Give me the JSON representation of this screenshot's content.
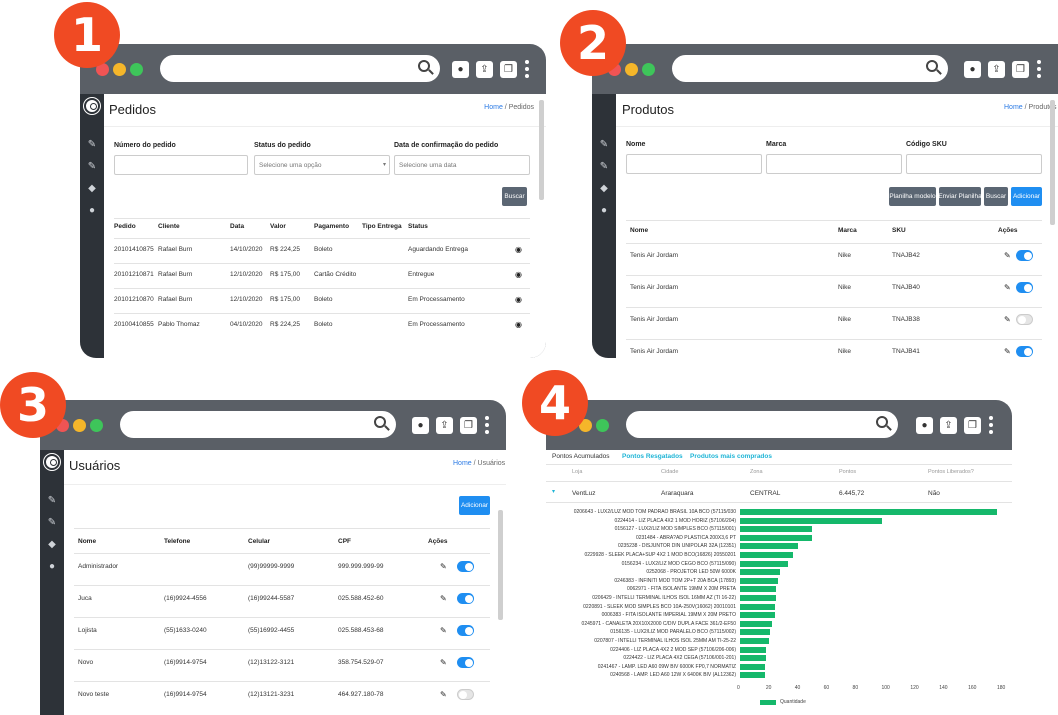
{
  "badges": [
    "1",
    "2",
    "3",
    "4"
  ],
  "colors": {
    "sidebar": "#2d3238",
    "accent": "#1f8ef1",
    "badge": "#f04a23",
    "bar": "#15b86b"
  },
  "p1": {
    "title": "Pedidos",
    "crumb_home": "Home",
    "crumb_sep": " / ",
    "crumb_current": "Pedidos",
    "filters": {
      "order_number_label": "Número do pedido",
      "status_label": "Status do pedido",
      "status_placeholder": "Selecione uma opção",
      "date_label": "Data de confirmação do pedido",
      "date_placeholder": "Selecione uma data"
    },
    "search_button": "Buscar",
    "columns": [
      "Pedido",
      "Cliente",
      "Data",
      "Valor",
      "Pagamento",
      "Tipo Entrega",
      "Status"
    ],
    "rows": [
      [
        "20101410875",
        "Rafael Burn",
        "14/10/2020",
        "R$ 224,25",
        "Boleto",
        "",
        "Aguardando Entrega"
      ],
      [
        "20101210871",
        "Rafael Burn",
        "12/10/2020",
        "R$ 175,00",
        "Cartão Crédito",
        "",
        "Entregue"
      ],
      [
        "20101210870",
        "Rafael Burn",
        "12/10/2020",
        "R$ 175,00",
        "Boleto",
        "",
        "Em Processamento"
      ],
      [
        "20100410855",
        "Pablo Thomaz",
        "04/10/2020",
        "R$ 224,25",
        "Boleto",
        "",
        "Em Processamento"
      ]
    ]
  },
  "p2": {
    "title": "Produtos",
    "crumb_home": "Home",
    "crumb_sep": " / ",
    "crumb_current": "Produtos",
    "filters": {
      "name_label": "Nome",
      "brand_label": "Marca",
      "sku_label": "Código SKU"
    },
    "buttons": {
      "template": "Planilha modelo",
      "upload": "Enviar Planilha",
      "search": "Buscar",
      "add": "Adicionar"
    },
    "columns": [
      "Nome",
      "Marca",
      "SKU",
      "Ações"
    ],
    "rows": [
      {
        "name": "Tenis Air Jordam",
        "brand": "Nike",
        "sku": "TNAJB42",
        "active": true
      },
      {
        "name": "Tenis Air Jordam",
        "brand": "Nike",
        "sku": "TNAJB40",
        "active": true
      },
      {
        "name": "Tenis Air Jordam",
        "brand": "Nike",
        "sku": "TNAJB38",
        "active": false
      },
      {
        "name": "Tenis Air Jordam",
        "brand": "Nike",
        "sku": "TNAJB41",
        "active": true
      }
    ]
  },
  "p3": {
    "title": "Usuários",
    "crumb_home": "Home",
    "crumb_sep": " / ",
    "crumb_current": "Usuários",
    "add_button": "Adicionar",
    "columns": [
      "Nome",
      "Telefone",
      "Celular",
      "CPF",
      "Ações"
    ],
    "rows": [
      {
        "name": "Administrador",
        "phone": "",
        "mobile": "(99)99999-9999",
        "cpf": "999.999.999-99",
        "active": true
      },
      {
        "name": "Juca",
        "phone": "(16)9924-4556",
        "mobile": "(16)99244-5587",
        "cpf": "025.588.452-60",
        "active": true
      },
      {
        "name": "Lojista",
        "phone": "(55)1633-0240",
        "mobile": "(55)16992-4455",
        "cpf": "025.588.453-68",
        "active": true
      },
      {
        "name": "Novo",
        "phone": "(16)9914-9754",
        "mobile": "(12)13122-3121",
        "cpf": "358.754.529-07",
        "active": true
      },
      {
        "name": "Novo teste",
        "phone": "(16)9914-9754",
        "mobile": "(12)13121-3231",
        "cpf": "464.927.180-78",
        "active": false
      }
    ]
  },
  "p4": {
    "tabs": [
      "Pontos Acumulados",
      "Pontos Resgatados",
      "Produtos mais comprados"
    ],
    "columns": [
      "Loja",
      "Cidade",
      "Zona",
      "Pontos",
      "Pontos Liberados?"
    ],
    "row": {
      "store": "VentLuz",
      "city": "Araraquara",
      "zone": "CENTRAL",
      "points": "6.445,72",
      "released": "Não"
    },
    "chart_data": {
      "type": "bar",
      "orientation": "horizontal",
      "categories": [
        "0206643 - LUX2/LUZ MOD TOM PADRAO BRASIL 10A BCO (57115/030",
        "0224414 - LIZ PLACA 4X2 1 MOD HORIZ (57106/204)",
        "0156127 - LUX2/LIZ MOD SIMPLES BCO (57115/001)",
        "0231484 - ABRA?AD PLASTICA 200X3,6 PT",
        "0235238 - DISJUNTOR DIN UNIPOLAR 32A (12351)",
        "0229928 - SLEEK PLACA+SUP 4X2 1 MOD BCO(16826) 20550201",
        "0156234 - LUX2/LIZ MOD CEGO BCO (57115/090)",
        "0252068 - PROJETOR LED 50W 6000K",
        "0246383 - INFINITI MOD TOM 2P+T 20A BCA (17893)",
        "0062971 - FITA ISOLANTE 19MM X 20M PRETA",
        "0206429 - INTELLI TERMINAL ILHOS ISOL 16MM AZ (TI 16-22)",
        "0220891 - SLEEK MOD SIMPLES BCO 10A-250V(16062) 20010101",
        "0006383 - FITA ISOLANTE IMPERIAL 19MM X 20M PRETO",
        "0245971 - CANALETA 20X10X2000 C/DIV DUPLA FACE 361/2-EF50",
        "0156135 - LUX2/LIZ MOD PARALELO BCO (57115/002)",
        "0207807 - INTELLI TERMINAL ILHOS ISOL 25MM AM TI-25-22",
        "0224406 - LIZ PLACA 4X2 2 MOD SEP (57106/206-006)",
        "0224422 - LIZ PLACA 4X2 CEGA (57106/001-201)",
        "0241467 - LAMP. LED A60 09W BIV 6000K FP0,7 NORMATIZ",
        "0240568 - LAMP. LED A60 12W X 6400K BIV (AL12362)"
      ],
      "values": [
        178,
        98,
        50,
        50,
        40,
        37,
        33,
        28,
        26,
        25,
        25,
        24,
        24,
        22,
        21,
        20,
        18,
        18,
        17,
        17
      ],
      "xlim": [
        0,
        180
      ],
      "xticks": [
        "0",
        "20",
        "40",
        "60",
        "80",
        "100",
        "120",
        "140",
        "160",
        "180"
      ],
      "series": [
        {
          "name": "Quantidade"
        }
      ],
      "legend": "bottom-left"
    }
  }
}
